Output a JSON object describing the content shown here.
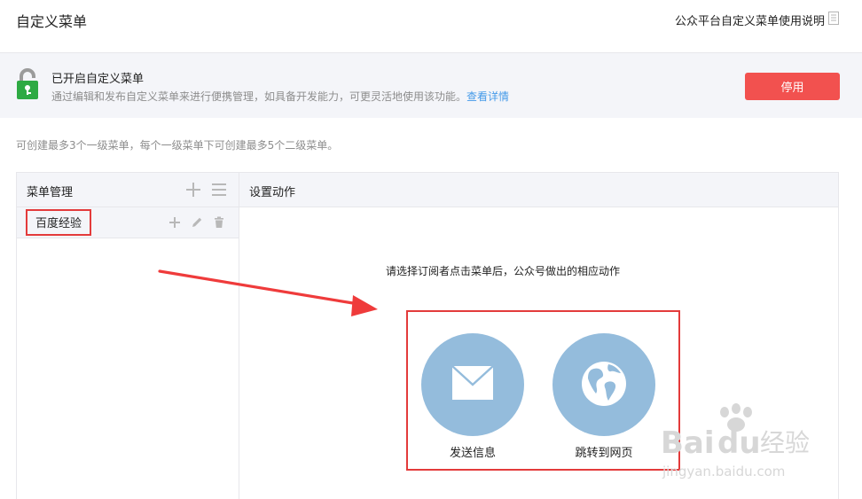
{
  "header": {
    "title": "自定义菜单",
    "help_link": "公众平台自定义菜单使用说明"
  },
  "banner": {
    "status_title": "已开启自定义菜单",
    "description": "通过编辑和发布自定义菜单来进行便携管理，如具备开发能力，可更灵活地使用该功能。",
    "details_link": "查看详情",
    "disable_label": "停用"
  },
  "limit_note": "可创建最多3个一级菜单，每个一级菜单下可创建最多5个二级菜单。",
  "menu_panel": {
    "title": "菜单管理",
    "items": [
      {
        "label": "百度经验"
      }
    ]
  },
  "action_panel": {
    "title": "设置动作",
    "prompt": "请选择订阅者点击菜单后，公众号做出的相应动作",
    "actions": [
      {
        "label": "发送信息",
        "icon": "envelope-icon"
      },
      {
        "label": "跳转到网页",
        "icon": "globe-icon"
      }
    ]
  },
  "watermark": {
    "brand": "Bai",
    "brand_suffix": "du",
    "product": "经验",
    "url": "jingyan.baidu.com"
  },
  "colors": {
    "danger": "#f2514f",
    "link": "#459ae9",
    "action_circle": "#94bcdc",
    "highlight": "#e33b3b",
    "lock_green": "#2eaa43"
  }
}
